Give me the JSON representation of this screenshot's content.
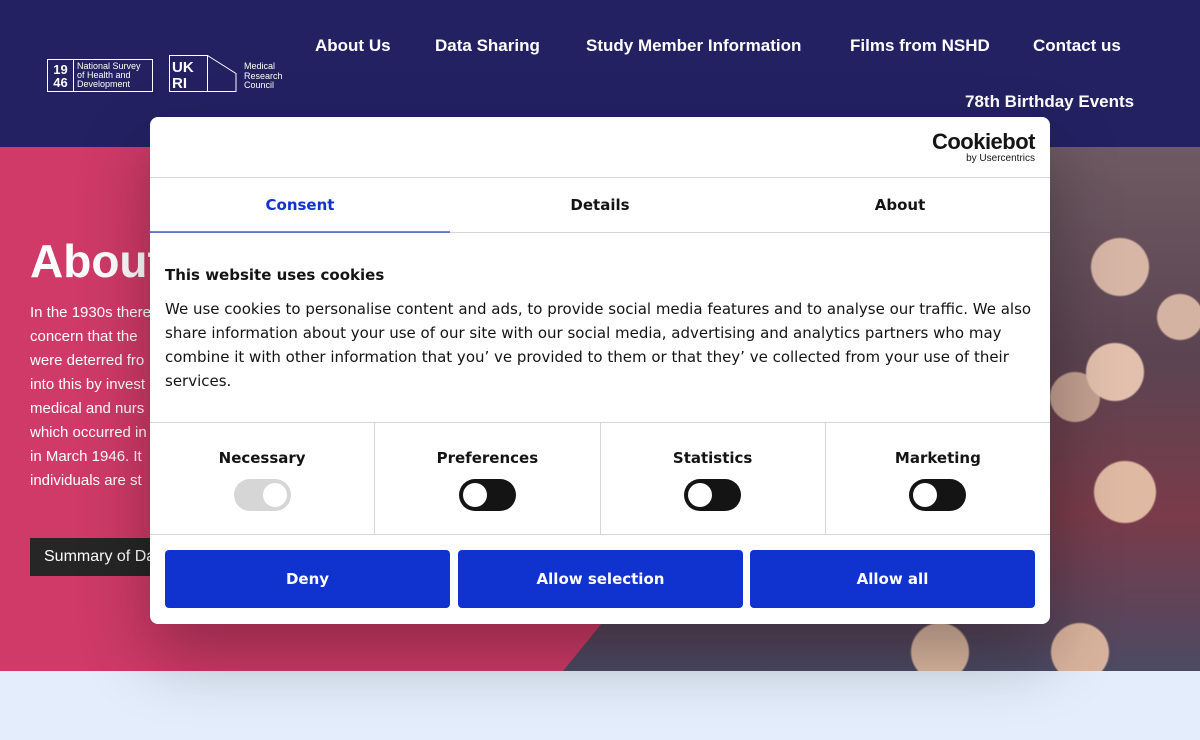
{
  "header": {
    "logo_years_top": "19",
    "logo_years_bottom": "46",
    "logo_text": [
      "National Survey",
      "of Health and",
      "Development"
    ],
    "ukri_text": [
      "UK",
      "RI"
    ],
    "mrc_text": [
      "Medical",
      "Research",
      "Council"
    ],
    "nav": [
      {
        "label": "About Us"
      },
      {
        "label": "Data Sharing"
      },
      {
        "label": "Study Member Information"
      },
      {
        "label": "Films from NSHD"
      },
      {
        "label": "Contact us"
      },
      {
        "label": "78th Birthday Events"
      }
    ]
  },
  "hero": {
    "title": "About",
    "lines": [
      "In the 1930s there",
      "concern that the",
      "were deterred fro",
      "into this by invest",
      "medical and nurs",
      "which occurred in",
      "in March 1946. It",
      "individuals are st"
    ],
    "button_label": "Summary of Da"
  },
  "cookie_dialog": {
    "brand": "Cookiebot",
    "brand_sub": "by Usercentrics",
    "tabs": [
      {
        "label": "Consent",
        "active": true
      },
      {
        "label": "Details",
        "active": false
      },
      {
        "label": "About",
        "active": false
      }
    ],
    "title": "This website uses cookies",
    "text": "We use cookies to personalise content and ads, to provide social media features and to analyse our traffic. We also share information about your use of our site with our social media, advertising and analytics partners who may combine it with other information that you’ ve provided to them or that they’ ve collected from your use of their services.",
    "toggles": [
      {
        "label": "Necessary",
        "state": "on-disabled"
      },
      {
        "label": "Preferences",
        "state": "off"
      },
      {
        "label": "Statistics",
        "state": "off"
      },
      {
        "label": "Marketing",
        "state": "off"
      }
    ],
    "buttons": {
      "deny": "Deny",
      "allow_selection": "Allow selection",
      "allow_all": "Allow all"
    }
  },
  "colors": {
    "header_bg": "#232162",
    "hero_bg": "#cf3a68",
    "primary_button": "#1032cf",
    "page_bg": "#e3edfb"
  }
}
